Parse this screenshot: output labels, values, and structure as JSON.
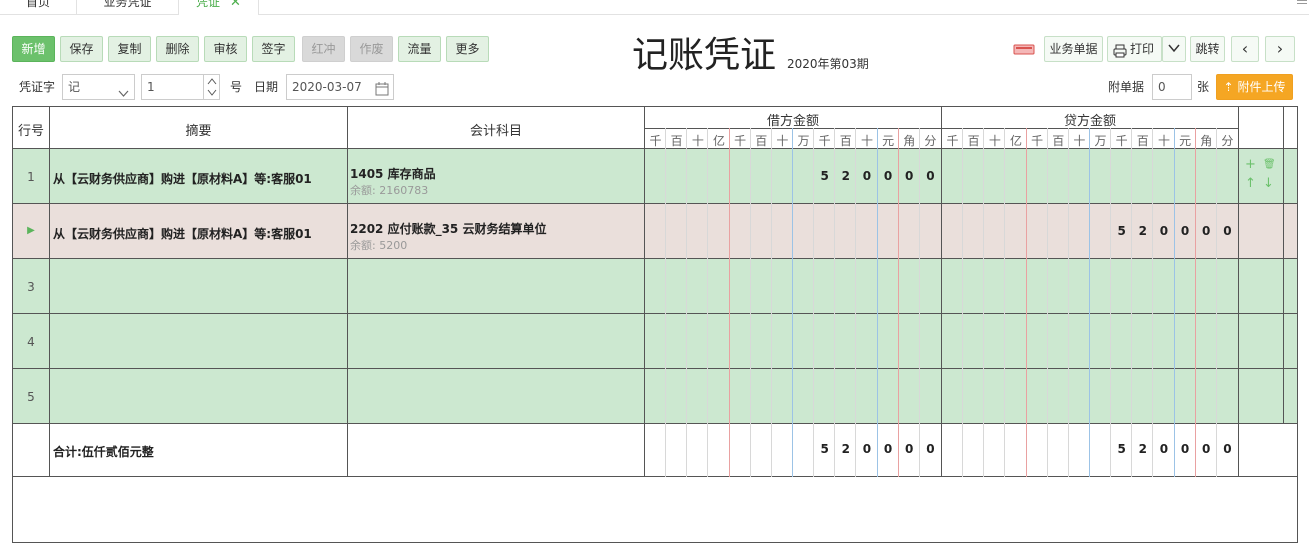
{
  "tabs": [
    {
      "label": "首页"
    },
    {
      "label": "业务凭证"
    },
    {
      "label": "凭证",
      "close": "✕"
    }
  ],
  "toolbar": {
    "buttons": [
      "新增",
      "保存",
      "复制",
      "删除",
      "审核",
      "签字",
      "红冲",
      "作废",
      "流量",
      "更多"
    ],
    "right": {
      "biz_docs": "业务单据",
      "print": "打印",
      "jump": "跳转",
      "prev": "‹",
      "next": "›"
    }
  },
  "header": {
    "title": "记账凭证",
    "period": "2020年第03期"
  },
  "form": {
    "voucher_word_label": "凭证字",
    "voucher_word_value": "记",
    "voucher_no_value": "1",
    "no_label": "号",
    "date_label": "日期",
    "date_value": "2020-03-07",
    "attach_label": "附单据",
    "attach_value": "0",
    "attach_unit": "张",
    "upload_label": "附件上传"
  },
  "grid": {
    "col_rownum": "行号",
    "col_summary": "摘要",
    "col_account": "会计科目",
    "col_debit": "借方金额",
    "col_credit": "贷方金额",
    "units": [
      "千",
      "百",
      "十",
      "亿",
      "千",
      "百",
      "十",
      "万",
      "千",
      "百",
      "十",
      "元",
      "角",
      "分"
    ],
    "rows": [
      {
        "num": "1",
        "summary": "从【云财务供应商】购进【原材料A】等:客服01",
        "account": "1405  库存商品",
        "balance": "余额: 2160783",
        "debit": [
          "5",
          "2",
          "0",
          "0",
          "0",
          "0"
        ],
        "credit": []
      },
      {
        "num": "▶",
        "summary": "从【云财务供应商】购进【原材料A】等:客服01",
        "account": "2202  应付账款_35 云财务结算单位",
        "balance": "余额: 5200",
        "debit": [],
        "credit": [
          "5",
          "2",
          "0",
          "0",
          "0",
          "0"
        ]
      },
      {
        "num": "3",
        "summary": "",
        "account": "",
        "balance": "",
        "debit": [],
        "credit": []
      },
      {
        "num": "4",
        "summary": "",
        "account": "",
        "balance": "",
        "debit": [],
        "credit": []
      },
      {
        "num": "5",
        "summary": "",
        "account": "",
        "balance": "",
        "debit": [],
        "credit": []
      }
    ],
    "total_label": "合计:伍仟贰佰元整",
    "total_debit": [
      "5",
      "2",
      "0",
      "0",
      "0",
      "0"
    ],
    "total_credit": [
      "5",
      "2",
      "0",
      "0",
      "0",
      "0"
    ]
  },
  "icons": {
    "add": "plus-icon",
    "delete": "trash-icon",
    "up": "arrow-up-icon",
    "down": "arrow-down-icon",
    "print": "printer-icon",
    "calendar": "calendar-icon",
    "scanner": "scanner-icon"
  }
}
